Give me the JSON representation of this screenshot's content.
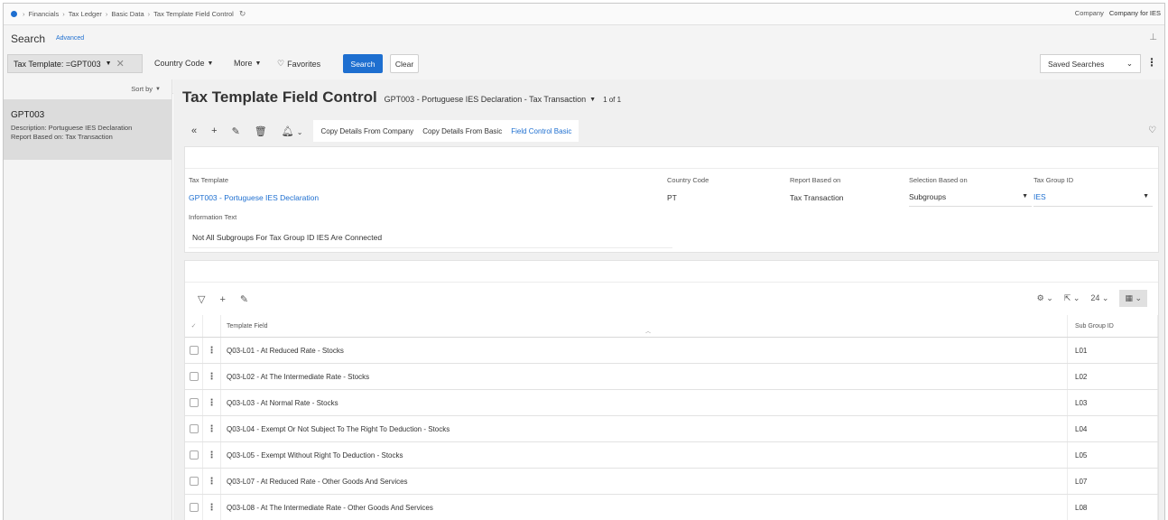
{
  "breadcrumb": [
    "Financials",
    "Tax Ledger",
    "Basic Data",
    "Tax Template Field Control"
  ],
  "company": {
    "label": "Company",
    "value": "Company for IES"
  },
  "search": {
    "title": "Search",
    "advanced": "Advanced",
    "chip": "Tax Template: =GPT003",
    "filters": [
      "Country Code",
      "More",
      "Favorites"
    ],
    "search_btn": "Search",
    "clear_btn": "Clear",
    "saved_searches": "Saved Searches"
  },
  "left": {
    "sort_by": "Sort by",
    "record": {
      "id": "GPT003",
      "description": "Description:  Portuguese IES Declaration",
      "report_based": "Report Based on:  Tax Transaction"
    }
  },
  "header": {
    "title": "Tax Template Field Control",
    "record_selector": "GPT003 - Portuguese IES Declaration - Tax Transaction",
    "count": "1 of 1"
  },
  "commands": [
    "Copy Details From Company",
    "Copy Details From Basic",
    "Field Control Basic"
  ],
  "form": {
    "tax_template_label": "Tax Template",
    "tax_template_value": "GPT003 - Portuguese IES Declaration",
    "country_code_label": "Country Code",
    "country_code_value": "PT",
    "report_based_label": "Report Based on",
    "report_based_value": "Tax Transaction",
    "selection_label": "Selection Based on",
    "selection_value": "Subgroups",
    "tax_group_label": "Tax Group ID",
    "tax_group_value": "IES",
    "info_label": "Information Text",
    "info_value": "Not All Subgroups For Tax Group ID IES Are Connected"
  },
  "table": {
    "page_size": "24",
    "columns": [
      "Template Field",
      "Sub Group ID"
    ],
    "rows": [
      {
        "field": "Q03-L01 - At Reduced Rate - Stocks",
        "sub": "L01"
      },
      {
        "field": "Q03-L02 - At The Intermediate Rate - Stocks",
        "sub": "L02"
      },
      {
        "field": "Q03-L03 - At Normal Rate - Stocks",
        "sub": "L03"
      },
      {
        "field": "Q03-L04 - Exempt Or Not Subject To The Right To Deduction - Stocks",
        "sub": "L04"
      },
      {
        "field": "Q03-L05 - Exempt Without Right To Deduction - Stocks",
        "sub": "L05"
      },
      {
        "field": "Q03-L07 - At Reduced Rate - Other Goods And Services",
        "sub": "L07"
      },
      {
        "field": "Q03-L08 - At The Intermediate Rate - Other Goods And Services",
        "sub": "L08"
      }
    ]
  },
  "colors": {
    "accent": "#1e6fd0"
  }
}
